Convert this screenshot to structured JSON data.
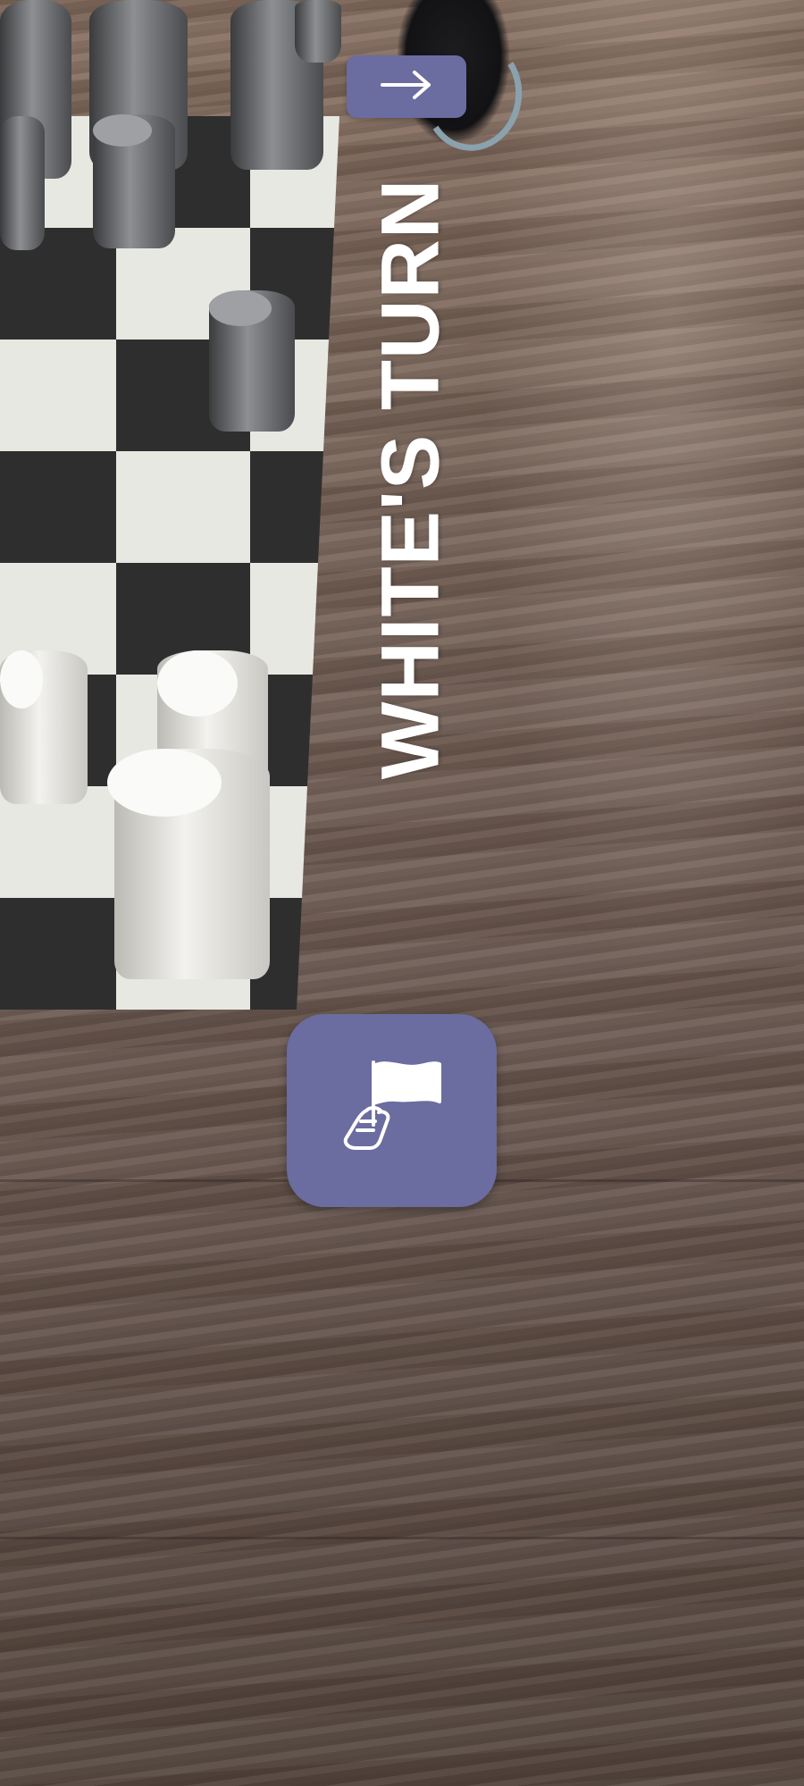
{
  "turn_indicator": {
    "text": "WHITE'S TURN"
  },
  "controls": {
    "next_icon": "arrow-right-icon",
    "resign_icon": "hand-white-flag-icon",
    "button_color": "#6b6ca0",
    "icon_color": "#ffffff"
  },
  "board": {
    "light_square_color": "#e7e8e2",
    "dark_square_color": "#2e2e2e"
  }
}
